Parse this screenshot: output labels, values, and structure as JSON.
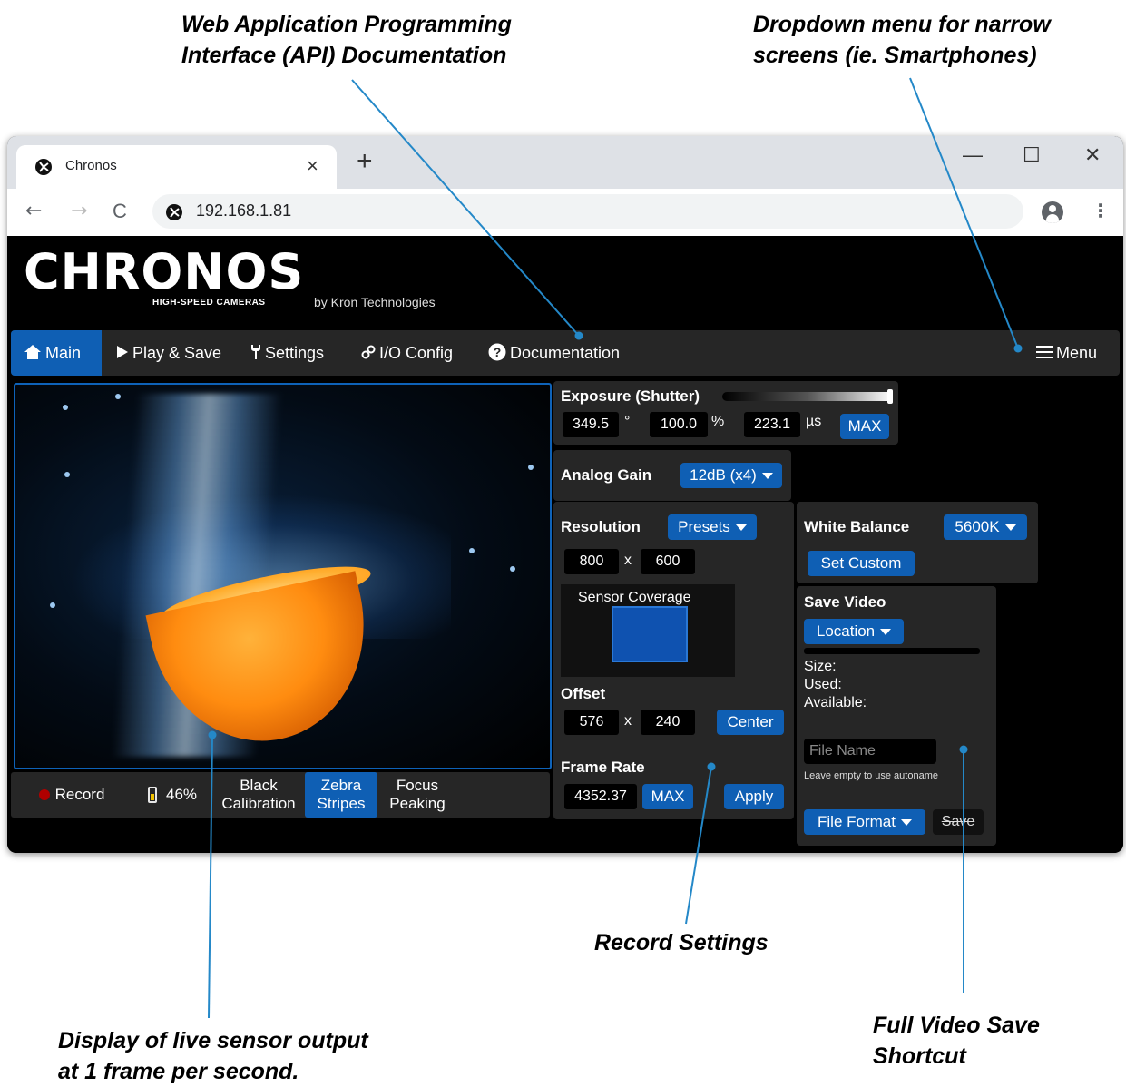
{
  "callouts": {
    "api_doc": "Web Application Programming\nInterface (API) Documentation",
    "dropdown": "Dropdown menu for narrow\nscreens (ie. Smartphones)",
    "live_display": "Display of live sensor output\nat 1 frame per second.",
    "record_settings": "Record Settings",
    "video_save": "Full Video Save\nShortcut"
  },
  "browser": {
    "tab_title": "Chronos",
    "tab_close": "×",
    "new_tab": "+",
    "minimize": "—",
    "maximize": "☐",
    "close": "✕",
    "back": "←",
    "forward": "→",
    "reload": "C",
    "url": "192.168.1.81",
    "menu": "⋮",
    "accent": "#0f5fb4"
  },
  "logo": {
    "main": "CHRONOS",
    "sub": "HIGH-SPEED CAMERAS",
    "by": "by Kron Technologies"
  },
  "nav": {
    "main": "Main",
    "play_save": "Play & Save",
    "settings": "Settings",
    "io_config": "I/O Config",
    "documentation": "Documentation",
    "menu": "Menu",
    "icons": {
      "main": "home-icon",
      "play_save": "play-icon",
      "settings": "wrench-icon",
      "io_config": "link-icon",
      "documentation": "question-icon",
      "menu": "hamburger-icon"
    }
  },
  "record_bar": {
    "record": "Record",
    "battery": "46%",
    "black_cal_1": "Black",
    "black_cal_2": "Calibration",
    "zebra_1": "Zebra",
    "zebra_2": "Stripes",
    "focus_1": "Focus",
    "focus_2": "Peaking"
  },
  "exposure": {
    "label": "Exposure (Shutter)",
    "degrees": "349.5",
    "degrees_unit": "°",
    "percent": "100.0",
    "percent_unit": "%",
    "time": "223.1",
    "time_unit": "µs",
    "max": "MAX",
    "slider_level": 1.0
  },
  "gain": {
    "label": "Analog Gain",
    "value": "12dB (x4)"
  },
  "resolution": {
    "label": "Resolution",
    "presets": "Presets",
    "width": "800",
    "x": "x",
    "height": "600",
    "coverage_label": "Sensor Coverage"
  },
  "offset": {
    "label": "Offset",
    "x_val": "576",
    "x": "x",
    "y_val": "240",
    "center": "Center"
  },
  "frame_rate": {
    "label": "Frame Rate",
    "value": "4352.37",
    "max": "MAX",
    "apply": "Apply"
  },
  "white_balance": {
    "label": "White Balance",
    "value": "5600K",
    "set_custom": "Set Custom"
  },
  "save_video": {
    "label": "Save Video",
    "location": "Location",
    "size": "Size:",
    "used": "Used:",
    "available": "Available:",
    "file_name_placeholder": "File Name",
    "hint": "Leave empty to use autoname",
    "file_format": "File Format",
    "save": "Save"
  }
}
